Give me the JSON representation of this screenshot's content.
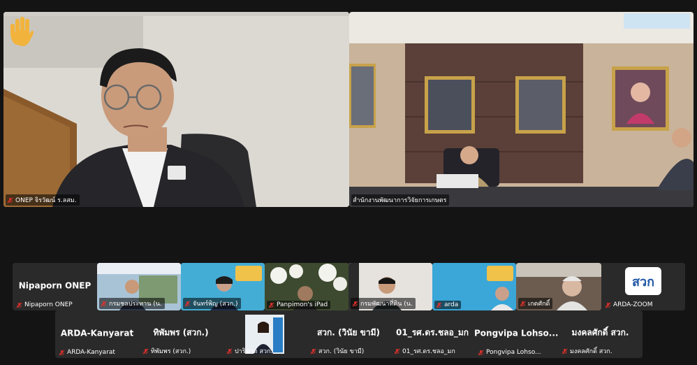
{
  "colors": {
    "mic_muted": "#e0302c",
    "raise_hand": "#f2b33d",
    "tile_bg": "#2a2a2a"
  },
  "speakers": [
    {
      "name": "ONEP จิรวัฒน์ ร.ลสม."
    },
    {
      "name": "สำนักงานพัฒนาการวิจัยการเกษตร"
    }
  ],
  "gallery_row1": [
    {
      "display": "Nipaporn ONEP",
      "name": "Nipaporn ONEP"
    },
    {
      "name": "กรมชลประทาน (น."
    },
    {
      "name": "จันทร์พิญ (สวก.)"
    },
    {
      "name": "Panpimon's iPad"
    },
    {
      "name": "กรมพัฒนาที่ดิน (น."
    },
    {
      "name": "arda"
    },
    {
      "name": "เกตศักดิ์"
    },
    {
      "name": "ARDA-ZOOM",
      "logo_text": "สวก"
    }
  ],
  "gallery_row2": [
    {
      "display": "ARDA-Kanyarat",
      "name": "ARDA-Kanyarat"
    },
    {
      "display": "ทิพัมพร (สวก.)",
      "name": "ทิพัมพร (สวก.)"
    },
    {
      "name": "ปาริชาต สวก."
    },
    {
      "display": "สวก. (วินัย ขามี)",
      "name": "สวก. (วินัย ขามี)"
    },
    {
      "display": "01_รศ.ดร.ชลอ_มก",
      "name": "01_รศ.ดร.ชลอ_มก"
    },
    {
      "display": "Pongvipa Lohso...",
      "name": "Pongvipa Lohso..."
    },
    {
      "display": "มงคลศักดิ์ สวก.",
      "name": "มงคลศักดิ์ สวก."
    }
  ],
  "icons": {
    "raise_hand": "raised-hand-icon",
    "mic": "mic-muted-icon"
  }
}
